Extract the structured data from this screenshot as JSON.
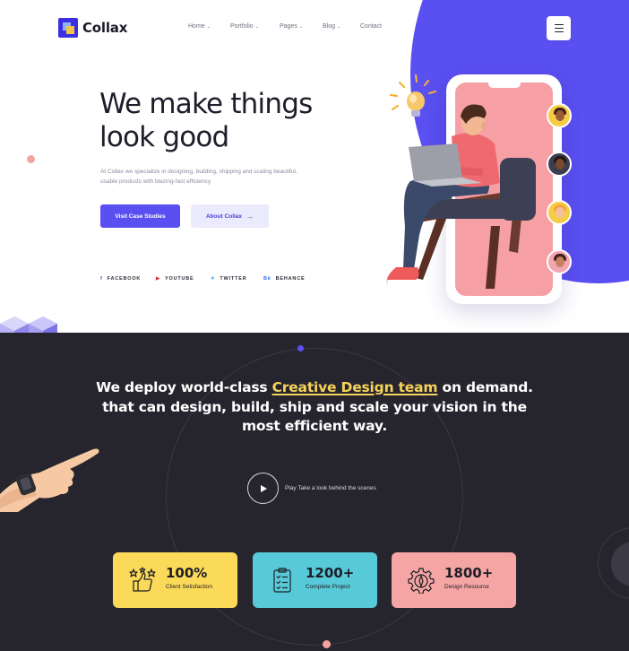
{
  "brand": {
    "name": "Collax"
  },
  "nav": {
    "items": [
      {
        "label": "Home",
        "has_dropdown": true
      },
      {
        "label": "Portfolio",
        "has_dropdown": true
      },
      {
        "label": "Pages",
        "has_dropdown": true
      },
      {
        "label": "Blog",
        "has_dropdown": true
      },
      {
        "label": "Contact",
        "has_dropdown": false
      }
    ],
    "menu_icon": "hamburger-icon"
  },
  "hero": {
    "title_line1": "We make things",
    "title_line2": "look good",
    "subtitle": "At Collax we specialize in designing, building, shipping and scaling beautiful, usable products with blazing-fast efficiency",
    "primary_button": "Visit Case Studies",
    "secondary_button": "About Collax",
    "secondary_icon": "arrow-right-icon"
  },
  "socials": [
    {
      "label": "FACEBOOK",
      "icon": "facebook-icon"
    },
    {
      "label": "YOUTUBE",
      "icon": "youtube-icon"
    },
    {
      "label": "TWITTER",
      "icon": "twitter-icon"
    },
    {
      "label": "BEHANCE",
      "icon": "behance-icon"
    }
  ],
  "showcase": {
    "headline_before": "We deploy world-class ",
    "headline_highlight": "Creative Design team",
    "headline_after": " on demand. that can design, build, ship and scale your vision in the most efficient way.",
    "play_label": "Play Take a look behind the scenes"
  },
  "stats": [
    {
      "value": "100%",
      "label": "Client Setisfaction",
      "icon": "thumbs-up-stars-icon",
      "color": "#fbd959"
    },
    {
      "value": "1200+",
      "label": "Complete Project",
      "icon": "clipboard-checklist-icon",
      "color": "#58c9d8"
    },
    {
      "value": "1800+",
      "label": "Design Resource",
      "icon": "gear-pen-icon",
      "color": "#f6a5a5"
    }
  ],
  "colors": {
    "accent": "#5a4ff0",
    "dark_bg": "#26252e",
    "highlight": "#f6d25a"
  }
}
